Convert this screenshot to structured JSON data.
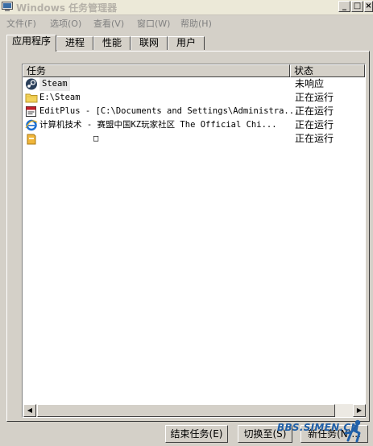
{
  "window": {
    "title": "Windows 任务管理器",
    "minimize": "_",
    "restore": "□",
    "close": "×"
  },
  "menu": [
    {
      "label": "文件(F)"
    },
    {
      "label": "选项(O)"
    },
    {
      "label": "查看(V)"
    },
    {
      "label": "窗口(W)"
    },
    {
      "label": "帮助(H)"
    }
  ],
  "tabs": [
    {
      "label": "应用程序",
      "active": true
    },
    {
      "label": "进程"
    },
    {
      "label": "性能"
    },
    {
      "label": "联网"
    },
    {
      "label": "用户"
    }
  ],
  "list": {
    "columns": {
      "task": "任务",
      "status": "状态"
    },
    "rows": [
      {
        "icon": "steam-icon",
        "task": "Steam",
        "status": "未响应"
      },
      {
        "icon": "folder-icon",
        "task": "E:\\Steam",
        "status": "正在运行"
      },
      {
        "icon": "editplus-icon",
        "task": "EditPlus - [C:\\Documents and Settings\\Administra...",
        "status": "正在运行"
      },
      {
        "icon": "ie-icon",
        "task": "计算机技术 - 赛盟中国KZ玩家社区 The Official Chi...",
        "status": "正在运行"
      },
      {
        "icon": "application-icon",
        "task": "□",
        "status": "正在运行"
      }
    ]
  },
  "buttons": {
    "end_task": "结束任务(E)",
    "switch_to": "切换至(S)",
    "new_task": "新任务(N)..."
  },
  "watermark": {
    "text": "BBS.SIMEN.CN"
  },
  "colors": {
    "accent": "#1f5fa8",
    "window_bg": "#d4d0c8"
  }
}
